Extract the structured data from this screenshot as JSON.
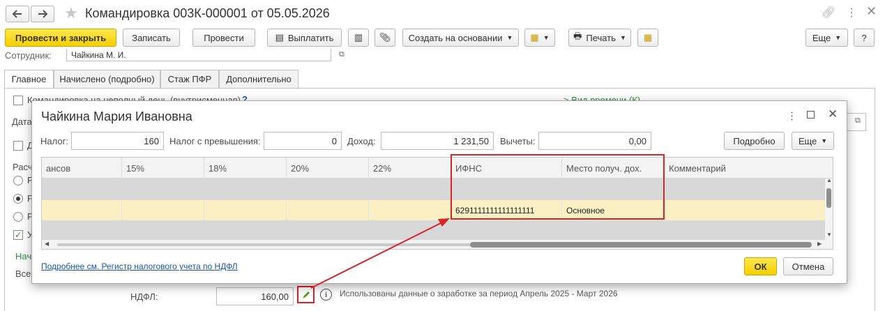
{
  "title": "Командировка 003К-000001 от 05.05.2026",
  "toolbar": {
    "post_close": "Провести и закрыть",
    "save": "Записать",
    "post": "Провести",
    "pay": "Выплатить",
    "create_based": "Создать на основании",
    "print": "Печать",
    "more": "Еще",
    "help": "?"
  },
  "form": {
    "employee_label": "Сотрудник:",
    "employee_value": "Чайкина М. И.",
    "partial_day": "Командировка на неполный день (внутрисменная)",
    "help_mark": "?",
    "time_type": "> Вид времени (К)",
    "date_label": "Дата",
    "partial_d": "Д",
    "calc_label": "Расч",
    "r1": "Р",
    "r2": "Р",
    "r3": "Р",
    "u_label": "У",
    "nach_label": "Нач",
    "vse_label": "Все",
    "ndfl_label": "НДФЛ:",
    "ndfl_value": "160,00",
    "info_text": "Использованы данные о заработке за период Апрель 2025 - Март 2026"
  },
  "tabs": [
    "Главное",
    "Начислено (подробно)",
    "Стаж ПФР",
    "Дополнительно"
  ],
  "dialog": {
    "title": "Чайкина Мария Ивановна",
    "tax_label": "Налог:",
    "tax_value": "160",
    "tax_over_label": "Налог с превышения:",
    "tax_over_value": "0",
    "income_label": "Доход:",
    "income_value": "1 231,50",
    "deductions_label": "Вычеты:",
    "deductions_value": "0,00",
    "details_btn": "Подробно",
    "more_btn": "Еще",
    "columns": [
      "ансов",
      "15%",
      "18%",
      "20%",
      "22%",
      "ИФНС",
      "Место получ. дох.",
      "Комментарий"
    ],
    "rows": [
      [
        "",
        "",
        "",
        "",
        "",
        "",
        "",
        ""
      ],
      [
        "",
        "",
        "",
        "",
        "",
        "6291111111111111111",
        "Основное",
        ""
      ]
    ],
    "link": "Подробнее см. Регистр налогового учета по НДФЛ",
    "ok": "ОК",
    "cancel": "Отмена"
  },
  "colors": {
    "accent": "#f5cf00",
    "highlight": "#d8232a",
    "link": "#1a55a8",
    "green": "#2e8b3e"
  }
}
